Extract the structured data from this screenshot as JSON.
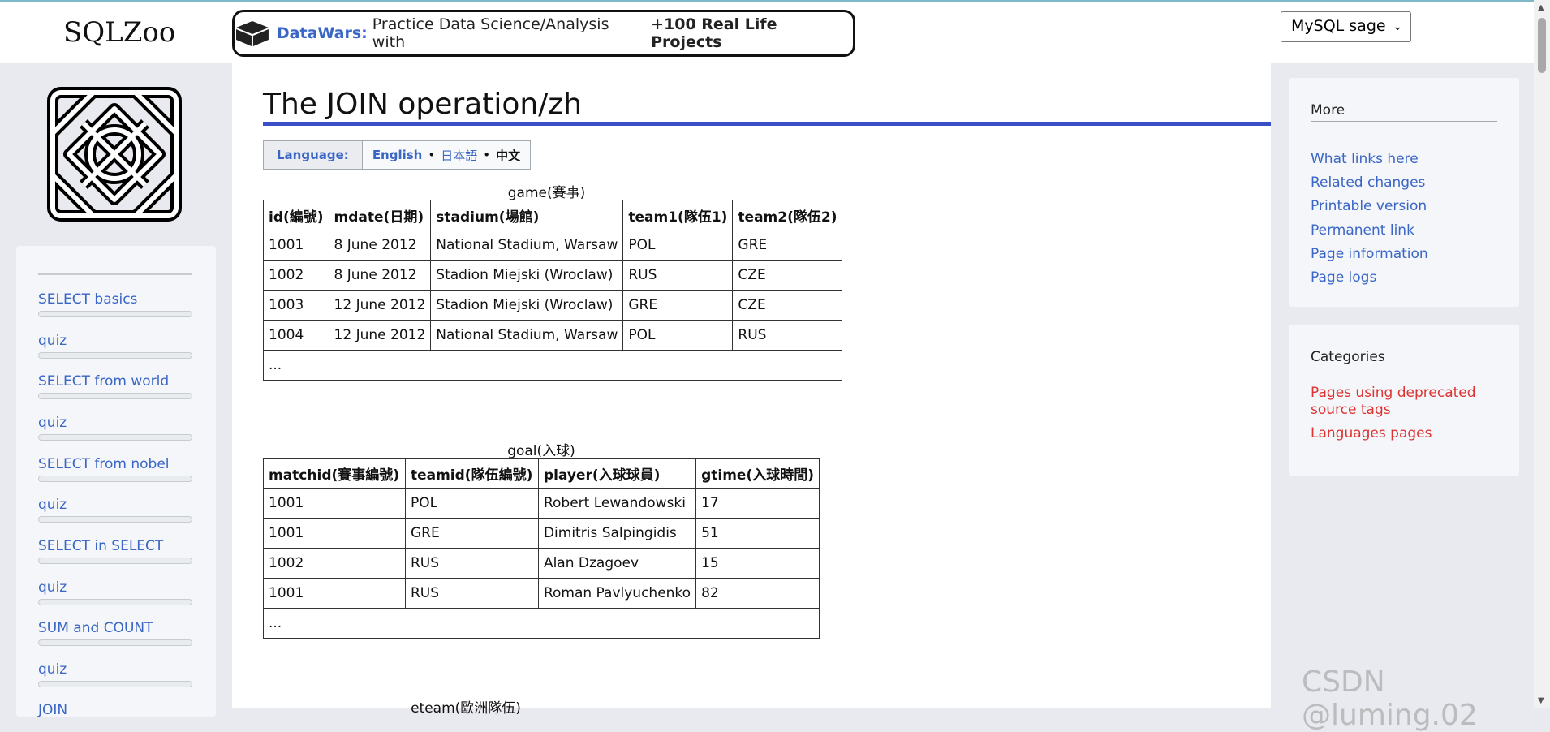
{
  "header": {
    "brand": "SQLZoo",
    "ad_brand": "DataWars:",
    "ad_text": "Practice Data Science/Analysis with",
    "ad_strong": "+100 Real Life Projects",
    "engine_select": "MySQL sage"
  },
  "sidebar": {
    "items": [
      {
        "label": "SELECT basics"
      },
      {
        "label": "quiz"
      },
      {
        "label": "SELECT from world"
      },
      {
        "label": "quiz"
      },
      {
        "label": "SELECT from nobel"
      },
      {
        "label": "quiz"
      },
      {
        "label": "SELECT in SELECT"
      },
      {
        "label": "quiz"
      },
      {
        "label": "SUM and COUNT"
      },
      {
        "label": "quiz"
      },
      {
        "label": "JOIN"
      }
    ]
  },
  "main": {
    "title": "The JOIN operation/zh",
    "language": {
      "label": "Language:",
      "english": "English",
      "japanese": "日本語",
      "chinese": "中文",
      "sep": "•"
    },
    "game": {
      "caption": "game(賽事)",
      "headers": [
        "id(編號)",
        "mdate(日期)",
        "stadium(場館)",
        "team1(隊伍1)",
        "team2(隊伍2)"
      ],
      "rows": [
        [
          "1001",
          "8 June 2012",
          "National Stadium, Warsaw",
          "POL",
          "GRE"
        ],
        [
          "1002",
          "8 June 2012",
          "Stadion Miejski (Wroclaw)",
          "RUS",
          "CZE"
        ],
        [
          "1003",
          "12 June 2012",
          "Stadion Miejski (Wroclaw)",
          "GRE",
          "CZE"
        ],
        [
          "1004",
          "12 June 2012",
          "National Stadium, Warsaw",
          "POL",
          "RUS"
        ]
      ],
      "more": "..."
    },
    "goal": {
      "caption": "goal(入球)",
      "headers": [
        "matchid(賽事編號)",
        "teamid(隊伍編號)",
        "player(入球球員)",
        "gtime(入球時間)"
      ],
      "rows": [
        [
          "1001",
          "POL",
          "Robert Lewandowski",
          "17"
        ],
        [
          "1001",
          "GRE",
          "Dimitris Salpingidis",
          "51"
        ],
        [
          "1002",
          "RUS",
          "Alan Dzagoev",
          "15"
        ],
        [
          "1001",
          "RUS",
          "Roman Pavlyuchenko",
          "82"
        ]
      ],
      "more": "..."
    },
    "eteam": {
      "caption": "eteam(歐洲隊伍)"
    }
  },
  "right": {
    "more_title": "More",
    "more_links": [
      "What links here",
      "Related changes",
      "Printable version",
      "Permanent link",
      "Page information",
      "Page logs"
    ],
    "categories_title": "Categories",
    "category_links": [
      "Pages using deprecated source tags",
      "Languages pages"
    ]
  },
  "watermark": "CSDN @luming.02",
  "colors": {
    "link": "#3a66c6",
    "redlink": "#dd3333",
    "title_rule": "#3a4fc5",
    "background": "#e8eaf0"
  }
}
